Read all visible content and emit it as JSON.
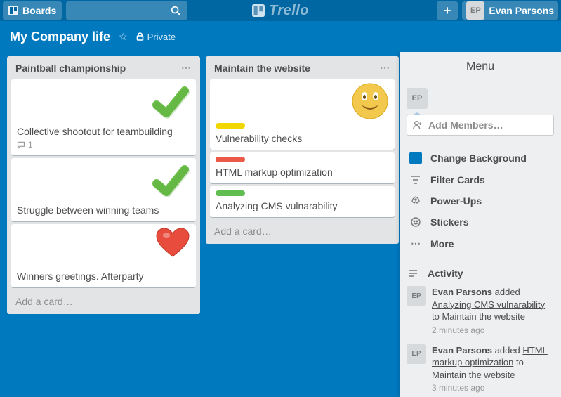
{
  "header": {
    "boards_label": "Boards",
    "logo_text": "Trello",
    "plus": "+",
    "user_initials": "EP",
    "user_name": "Evan Parsons"
  },
  "boardbar": {
    "title": "My Company life",
    "privacy_label": "Private"
  },
  "lists": [
    {
      "title": "Paintball championship",
      "cards": [
        {
          "title": "Collective shootout for teambuilding",
          "sticker": "check",
          "comments": "1"
        },
        {
          "title": "Struggle between winning teams",
          "sticker": "check"
        },
        {
          "title": "Winners greetings. Afterparty",
          "sticker": "heart"
        }
      ],
      "add_label": "Add a card…"
    },
    {
      "title": "Maintain the website",
      "cards": [
        {
          "title": "Vulnerability checks",
          "sticker": "smile",
          "label": "yellow"
        },
        {
          "title": "HTML markup optimization",
          "label": "red"
        },
        {
          "title": "Analyzing CMS vulnarability",
          "label": "green"
        }
      ],
      "add_label": "Add a card…"
    }
  ],
  "menu": {
    "title": "Menu",
    "member_initials": "EP",
    "add_members": "Add Members…",
    "items": {
      "change_bg": "Change Background",
      "filter": "Filter Cards",
      "powerups": "Power-Ups",
      "stickers": "Stickers",
      "more": "More"
    },
    "activity_label": "Activity",
    "activity": [
      {
        "actor_initials": "EP",
        "actor": "Evan Parsons",
        "verb": "added",
        "card": "Analyzing CMS vulnarability",
        "to": "to Maintain the website",
        "time": "2 minutes ago"
      },
      {
        "actor_initials": "EP",
        "actor": "Evan Parsons",
        "verb": "added",
        "card": "HTML markup optimization",
        "to": "to Maintain the website",
        "time": "3 minutes ago"
      }
    ]
  }
}
